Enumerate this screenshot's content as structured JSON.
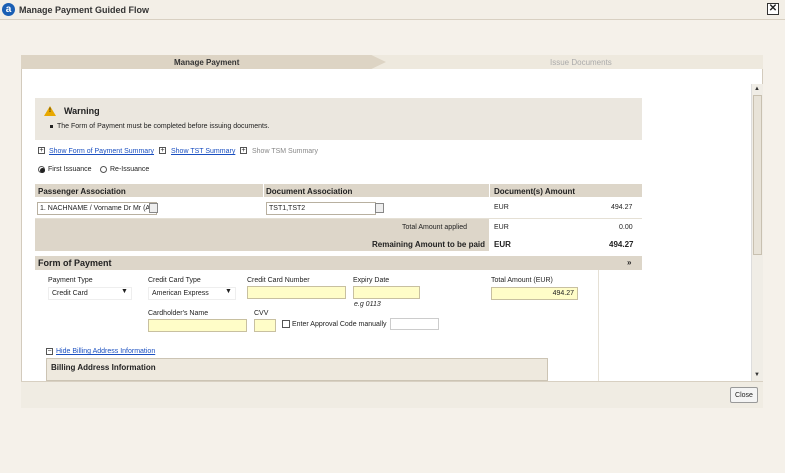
{
  "window": {
    "title": "Manage Payment Guided Flow",
    "close_symbol": "✕"
  },
  "steps": [
    "Manage Payment",
    "Issue Documents"
  ],
  "warning": {
    "title": "Warning",
    "message": "The Form of Payment must be completed before issuing documents."
  },
  "summary_links": [
    "Show Form of Payment Summary",
    "Show TST Summary",
    "Show TSM Summary"
  ],
  "issuance": {
    "options": [
      "First Issuance",
      "Re-Issuance"
    ],
    "selected": "First Issuance"
  },
  "association_table": {
    "headers": [
      "Passenger Association",
      "Document Association",
      "Document(s) Amount"
    ],
    "passenger_value": "1. NACHNAME / Vorname Dr Mr (A",
    "document_value": "TST1,TST2",
    "currency": "EUR",
    "amount": "494.27",
    "total_applied_label": "Total Amount applied",
    "total_applied_currency": "EUR",
    "total_applied_value": "0.00",
    "remaining_label": "Remaining Amount to be paid",
    "remaining_currency": "EUR",
    "remaining_value": "494.27"
  },
  "form_of_payment": {
    "title": "Form of Payment",
    "payment_type_label": "Payment Type",
    "payment_type_value": "Credit Card",
    "card_type_label": "Credit Card Type",
    "card_type_value": "American Express",
    "card_number_label": "Credit Card Number",
    "expiry_label": "Expiry Date",
    "expiry_hint": "e.g 0113",
    "total_label": "Total Amount (EUR)",
    "total_value": "494.27",
    "cardholder_label": "Cardholder's Name",
    "cvv_label": "CVV",
    "approval_label": "Enter Approval Code manually",
    "hide_billing_link": "Hide Billing Address Information",
    "billing_title": "Billing Address Information"
  },
  "footer": {
    "close_label": "Close"
  }
}
